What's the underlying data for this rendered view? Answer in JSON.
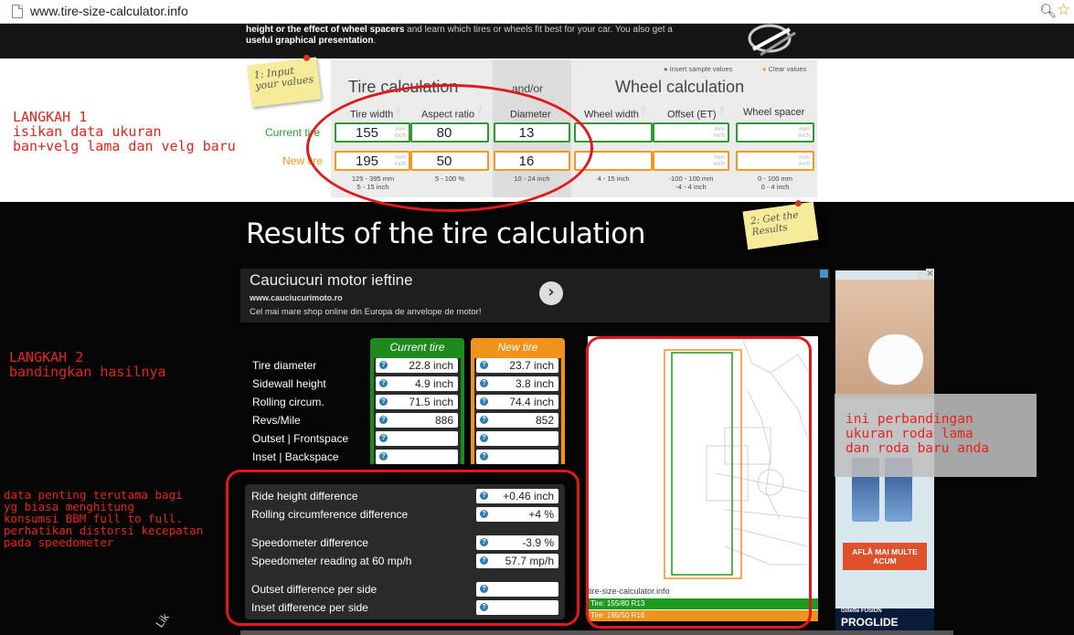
{
  "browser": {
    "url": "www.tire-size-calculator.info"
  },
  "header": {
    "intro_bold_1": "height or the effect of wheel spacers",
    "intro_text_1": " and learn which tires or wheels fit best for your car. You also get a",
    "intro_bold_2": "useful graphical presentation",
    "intro_text_2": "."
  },
  "input_panel": {
    "sticky_1": "1: Input your values",
    "insert_sample": "Insert sample values",
    "clear_values": "Clear values",
    "tire_section_title": "Tire calculation",
    "andor": "and/or",
    "wheel_section_title": "Wheel calculation",
    "columns": {
      "tire_width": "Tire width",
      "aspect_ratio": "Aspect ratio",
      "diameter": "Diameter",
      "wheel_width": "Wheel width",
      "offset": "Offset (ET)",
      "wheel_spacer": "Wheel spacer"
    },
    "rows": {
      "current": "Current tire",
      "new": "New tire"
    },
    "current": {
      "tire_width": "155",
      "aspect_ratio": "80",
      "diameter": "13",
      "wheel_width": "",
      "offset": "",
      "wheel_spacer": ""
    },
    "new": {
      "tire_width": "195",
      "aspect_ratio": "50",
      "diameter": "16",
      "wheel_width": "",
      "offset": "",
      "wheel_spacer": ""
    },
    "units": {
      "mm_inch": "mm\ninch",
      "inch": "inch",
      "mm": "mm"
    },
    "ranges": {
      "tire_width_1": "125 - 395 mm",
      "tire_width_2": "5 - 15 inch",
      "aspect_ratio": "5 - 100 %",
      "diameter": "10 - 24 inch",
      "wheel_width": "4 - 15 inch",
      "offset_1": "-100 - 100 mm",
      "offset_2": "-4 - 4 inch",
      "spacer_1": "0 - 100 mm",
      "spacer_2": "0 - 4 inch"
    }
  },
  "results": {
    "title": "Results of the tire calculation",
    "sticky_2": "2: Get the Results",
    "ad": {
      "headline": "Cauciucuri motor ieftine",
      "site": "www.cauciucurimoto.ro",
      "desc": "Cel mai mare shop online din Europa de anvelope de motor!",
      "go": "›"
    },
    "tab_current": "Current tire",
    "tab_new": "New tire",
    "q": "?",
    "labels": {
      "diameter": "Tire diameter",
      "sidewall": "Sidewall height",
      "circum": "Rolling circum.",
      "revs": "Revs/Mile",
      "outset": "Outset | Frontspace",
      "inset": "Inset | Backspace"
    },
    "current": {
      "diameter": "22.8 inch",
      "sidewall": "4.9 inch",
      "circum": "71.5 inch",
      "revs": "886",
      "outset": "",
      "inset": ""
    },
    "new": {
      "diameter": "23.7 inch",
      "sidewall": "3.8 inch",
      "circum": "74.4 inch",
      "revs": "852",
      "outset": "",
      "inset": ""
    },
    "diff_labels": {
      "ride": "Ride height difference",
      "circ": "Rolling circumference difference",
      "speedo": "Speedometer difference",
      "reading": "Speedometer reading at 60 mp/h",
      "outset": "Outset difference per side",
      "inset": "Inset difference per side"
    },
    "diff_values": {
      "ride": "+0.46 inch",
      "circ": "+4 %",
      "speedo": "-3.9 %",
      "reading": "57.7 mp/h",
      "outset": "",
      "inset": ""
    },
    "visual": {
      "watermark": "tire-size-calculator.info",
      "current_bar": "Tire: 155/80 R13",
      "new_bar": "Tire: 195/50 R16"
    }
  },
  "side_ad": {
    "cta": "AFLĂ MAI MULTE ACUM",
    "brand": "PROGLIDE",
    "brand_top": "Gillette FUSION"
  },
  "annotations": {
    "step1_l1": "LANGKAH 1",
    "step1_l2": "isikan data ukuran",
    "step1_l3": "ban+velg lama dan velg baru",
    "step2_l1": "LANGKAH 2",
    "step2_l2": "bandingkan hasilnya",
    "note_l1": "data penting terutama bagi",
    "note_l2": "yg biasa menghitung",
    "note_l3": "konsumsi BBM full to full.",
    "note_l4": "perhatikan distorsi kecepatan",
    "note_l5": "pada speedometer",
    "comp_l1": "ini perbandingan",
    "comp_l2": "ukuran roda lama",
    "comp_l3": "dan roda baru anda",
    "corner_text": "Lik"
  },
  "colors": {
    "green": "#2f9a2f",
    "orange": "#f29a1e",
    "annotation_red": "#e8231a"
  }
}
